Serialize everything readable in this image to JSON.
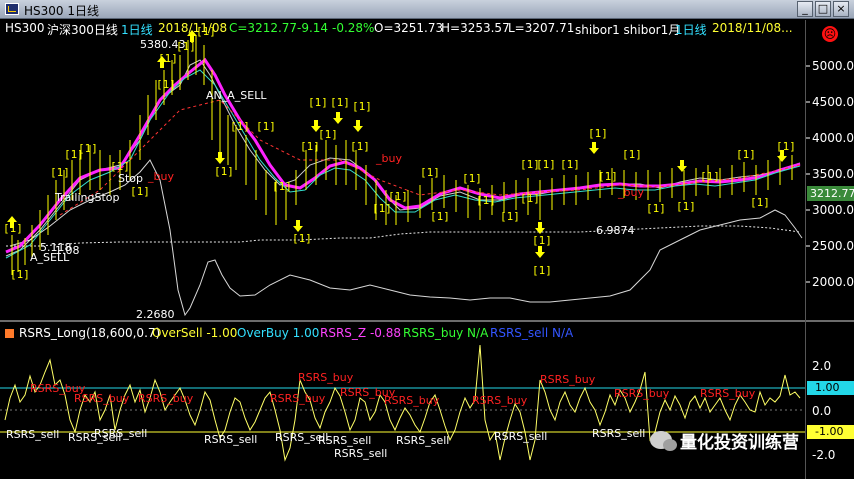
{
  "window": {
    "title": "HS300 1日线",
    "minimize": "_",
    "maximize": "□",
    "close": "×"
  },
  "info": {
    "symbol": "HS300",
    "name": "沪深300日线",
    "period": "1日线",
    "date": "2018/11/08",
    "close": "C=3212.77",
    "change": "-9.14",
    "pct": "-0.28%",
    "open": "O=3251.73",
    "high": "H=3253.57",
    "low": "L=3207.71",
    "shibor": "shibor1 shibor1月",
    "period2": "1日线",
    "date2": "2018/11/08..."
  },
  "price_axis": [
    "5000.00",
    "4500.00",
    "4000.00",
    "3500.00",
    "3000.00",
    "2500.00",
    "2000.00"
  ],
  "price_tag": "3212.77",
  "chart_labels": {
    "high": "5380.43",
    "low": "2.2680",
    "shibor_val": "6.9874",
    "left_val": "5.118",
    "left_val2": "1.08",
    "a_sell": "A_SELL",
    "an_sell": "AN_A_SELL",
    "trailing": "TrailingStop",
    "stop": "Stop",
    "rsrs_buy": "_buy",
    "bracket": "[1]"
  },
  "indicator": {
    "name": "RSRS_Long(18,600,0.7)",
    "oversell": "OverSell -1.00",
    "overbuy": "OverBuy 1.00",
    "z": "RSRS_Z -0.88",
    "buy": "RSRS_buy N/A",
    "sell": "RSRS_sell N/A",
    "axis": [
      "2.0",
      "1.00",
      "0.0",
      "-1.00",
      "-2.0"
    ],
    "buy_label": "RSRS_buy",
    "sell_label": "RSRS_sell"
  },
  "watermark": "量化投资训练营",
  "colors": {
    "info_yellow": "#ffff33",
    "info_green": "#33ff33",
    "info_cyan": "#33e0ff",
    "info_magenta": "#ff44ff",
    "info_blue": "#3355ff",
    "ma_magenta": "#ff22ff",
    "signal_yellow": "#ffff00",
    "sell_red": "#ff2222"
  }
}
